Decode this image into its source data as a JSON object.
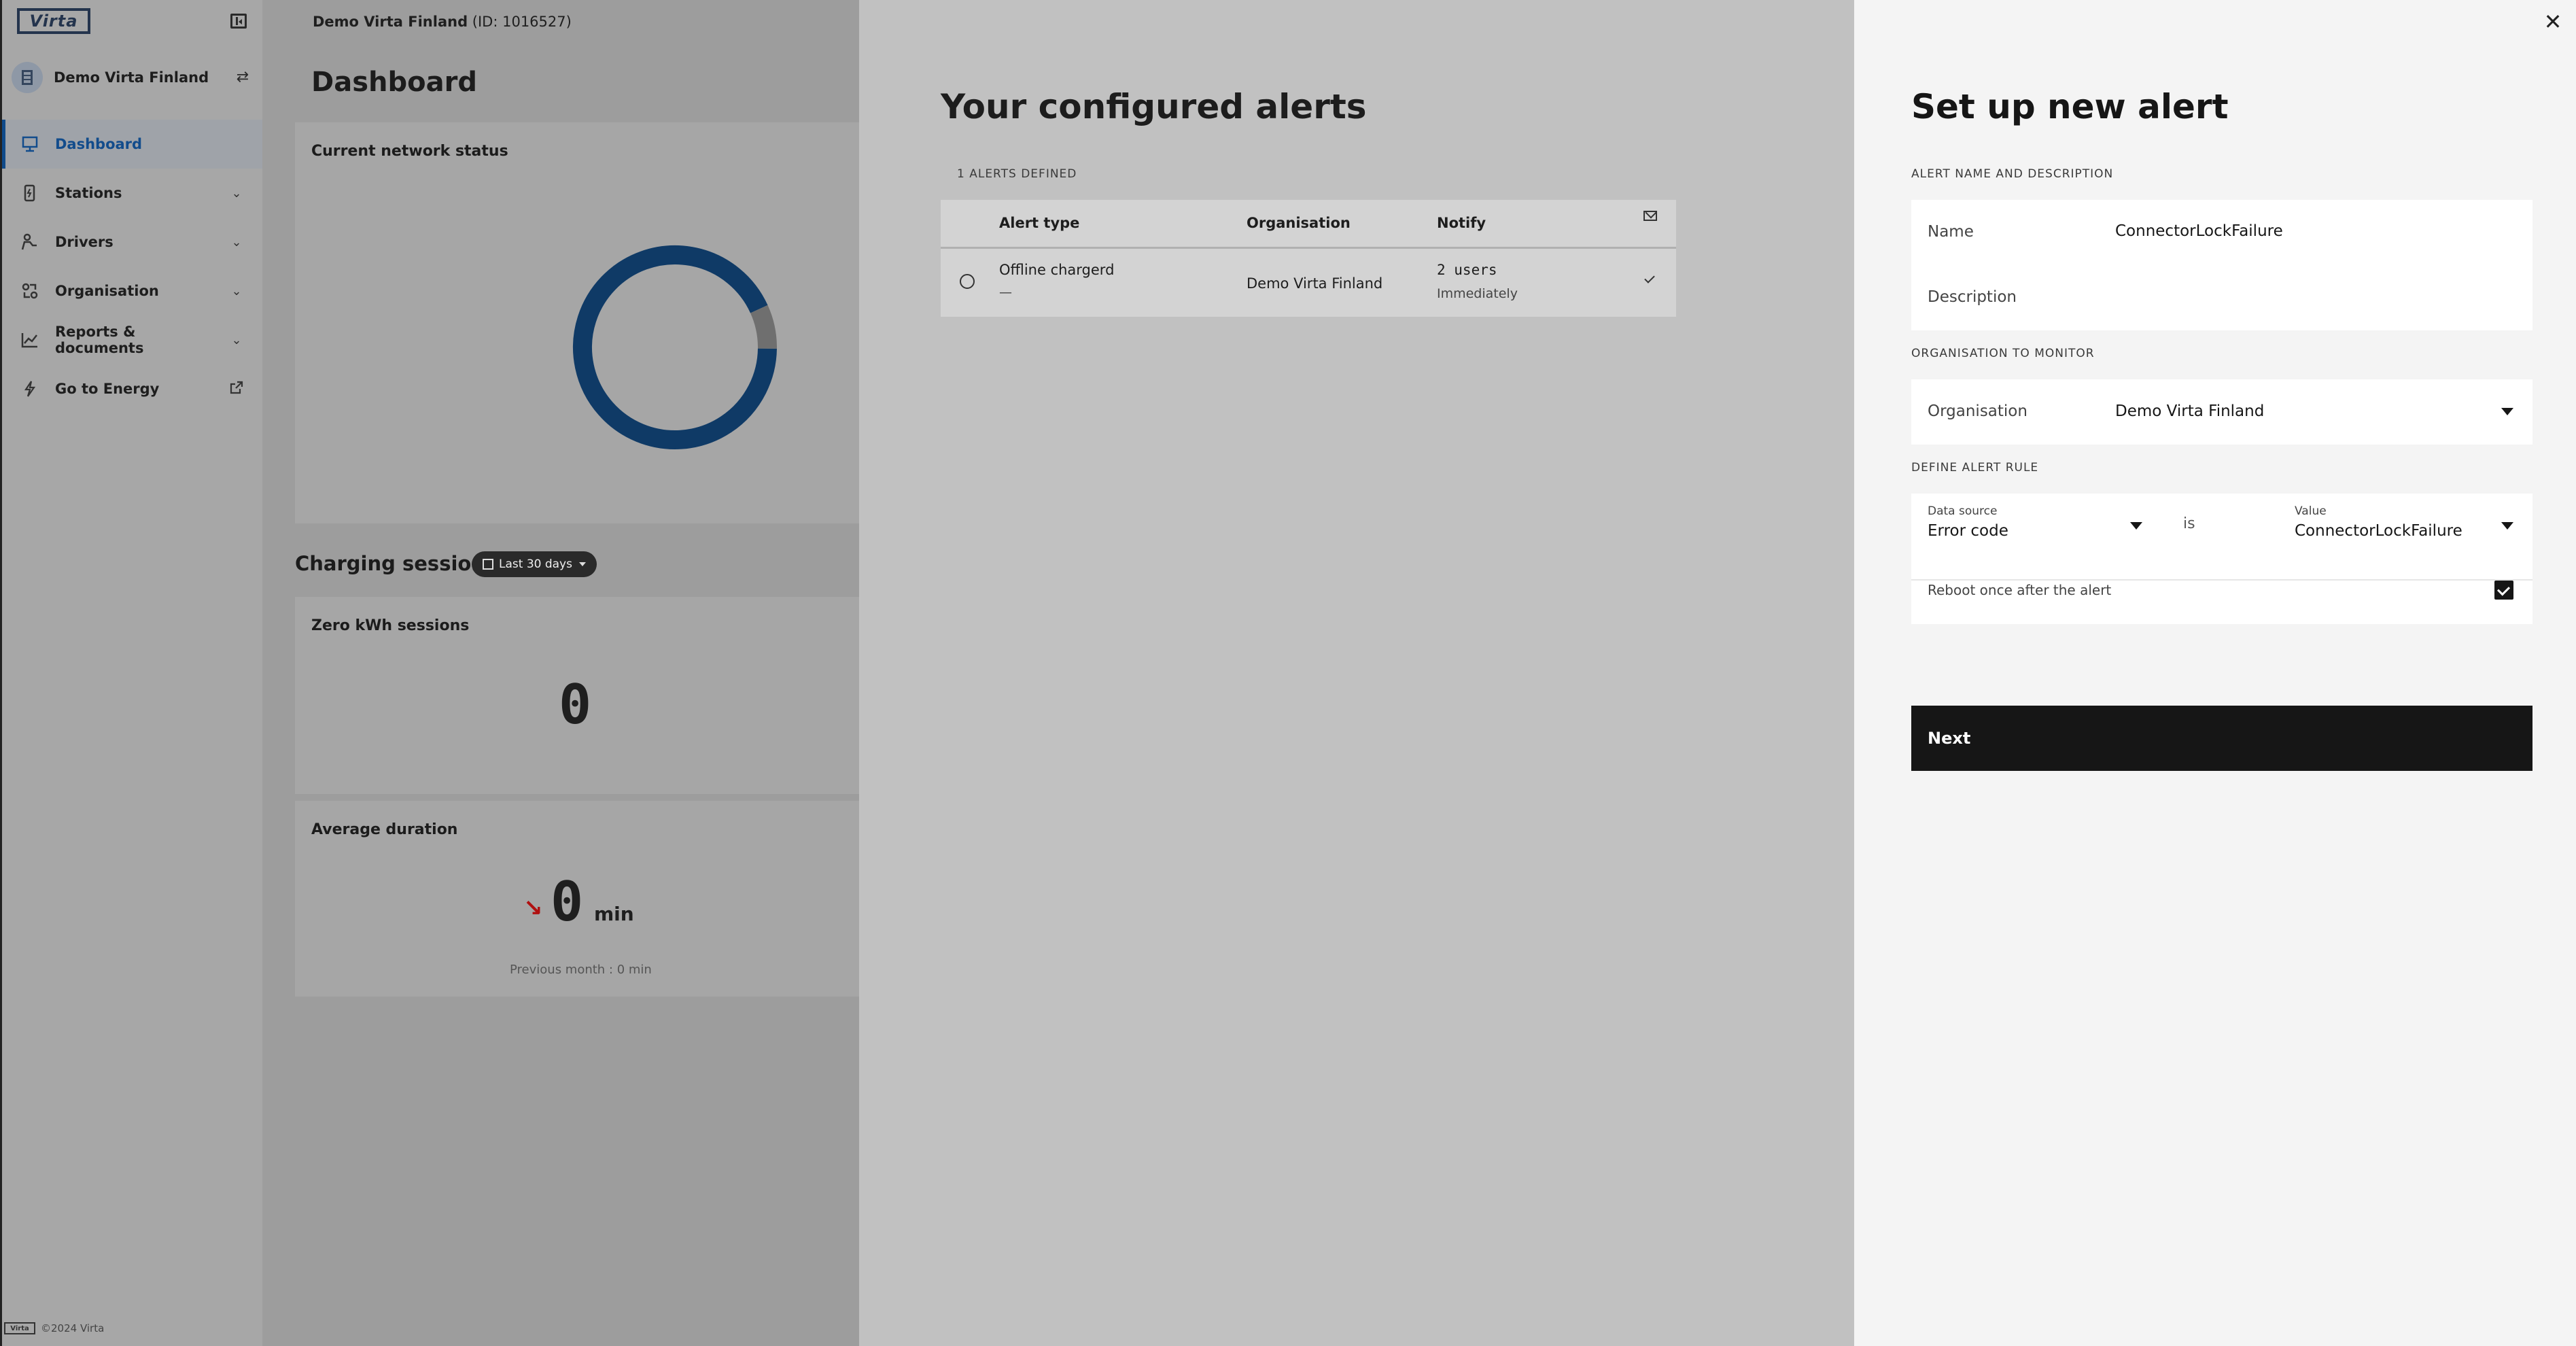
{
  "sidebar": {
    "logo_text": "Virta",
    "org_name": "Demo Virta Finland",
    "items": [
      {
        "label": "Dashboard",
        "icon": "dashboard-icon",
        "active": true
      },
      {
        "label": "Stations",
        "icon": "station-icon",
        "has_chevron": true
      },
      {
        "label": "Drivers",
        "icon": "drivers-icon",
        "has_chevron": true
      },
      {
        "label": "Organisation",
        "icon": "organisation-icon",
        "has_chevron": true
      },
      {
        "label": "Reports & documents",
        "icon": "chart-icon",
        "has_chevron": true
      },
      {
        "label": "Go to Energy",
        "icon": "lightning-icon",
        "external": true
      }
    ],
    "footer_logo": "Virta",
    "footer_text": "©2024 Virta"
  },
  "main": {
    "breadcrumb_org": "Demo Virta Finland",
    "breadcrumb_id": "(ID: 1016527)",
    "page_title": "Dashboard",
    "network_card_title": "Current network status",
    "donut": {
      "segments": [
        {
          "value": 93,
          "color": "#0f3a66"
        },
        {
          "value": 7,
          "color": "#6f6f6f"
        }
      ]
    },
    "charging_sessions_title": "Charging sessions",
    "date_range": "Last 30 days",
    "zero_kwh_title": "Zero kWh sessions",
    "zero_kwh_value": "0",
    "avg_duration_title": "Average duration",
    "avg_duration_value": "0",
    "avg_duration_unit": "min",
    "prev_month": "Previous month : 0 min"
  },
  "alerts": {
    "title": "Your configured alerts",
    "count_label": "1 ALERTS DEFINED",
    "columns": {
      "type": "Alert type",
      "org": "Organisation",
      "notify": "Notify"
    },
    "rows": [
      {
        "type": "Offline chargerd",
        "type_sub": "—",
        "org": "Demo Virta Finland",
        "notify": "2 users",
        "notify_sub": "Immediately"
      }
    ]
  },
  "setup": {
    "title": "Set up new alert",
    "section_name": "ALERT NAME AND DESCRIPTION",
    "name_label": "Name",
    "name_value": "ConnectorLockFailure",
    "description_label": "Description",
    "description_value": "",
    "section_org": "ORGANISATION TO MONITOR",
    "org_label": "Organisation",
    "org_value": "Demo Virta Finland",
    "section_rule": "DEFINE ALERT RULE",
    "data_source_label": "Data source",
    "data_source_value": "Error code",
    "is_text": "is",
    "value_label": "Value",
    "value_value": "ConnectorLockFailure",
    "reboot_label": "Reboot once after the alert",
    "reboot_checked": true,
    "next_label": "Next"
  }
}
